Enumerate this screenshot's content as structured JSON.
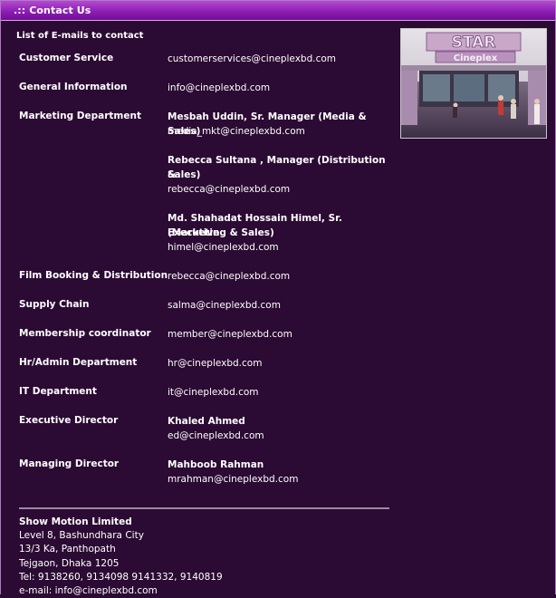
{
  "header": {
    "title": ".:: Contact Us"
  },
  "intro": "List of E-mails to contact",
  "contacts": [
    {
      "dept": "Customer Service",
      "lines": [
        {
          "t": "customerservices@cineplexbd.com",
          "b": false
        }
      ]
    },
    {
      "dept": "General Information",
      "lines": [
        {
          "t": "info@cineplexbd.com",
          "b": false
        }
      ]
    },
    {
      "dept": "Marketing Department",
      "lines": [
        {
          "t": "Mesbah Uddin, Sr. Manager (Media & Sales)",
          "b": true
        },
        {
          "t": "media_mkt@cineplexbd.com",
          "b": false
        },
        {
          "t": "",
          "b": false
        },
        {
          "t": "Rebecca Sultana , Manager (Distribution &",
          "b": true
        },
        {
          "t": "Sales)",
          "b": true
        },
        {
          "t": "rebecca@cineplexbd.com",
          "b": false
        },
        {
          "t": "",
          "b": false
        },
        {
          "t": "Md. Shahadat Hossain Himel, Sr. Executive",
          "b": true
        },
        {
          "t": "(Marketing & Sales)",
          "b": true
        },
        {
          "t": "himel@cineplexbd.com",
          "b": false
        }
      ]
    },
    {
      "dept": "Film Booking & Distribution",
      "lines": [
        {
          "t": "rebecca@cineplexbd.com",
          "b": false
        }
      ]
    },
    {
      "dept": "Supply Chain",
      "lines": [
        {
          "t": "salma@cineplexbd.com",
          "b": false
        }
      ]
    },
    {
      "dept": "Membership coordinator",
      "lines": [
        {
          "t": "member@cineplexbd.com",
          "b": false
        }
      ]
    },
    {
      "dept": "Hr/Admin Department",
      "lines": [
        {
          "t": "hr@cineplexbd.com",
          "b": false
        }
      ]
    },
    {
      "dept": "IT Department",
      "lines": [
        {
          "t": "it@cineplexbd.com",
          "b": false
        }
      ]
    },
    {
      "dept": "Executive Director",
      "lines": [
        {
          "t": "Khaled Ahmed",
          "b": true
        },
        {
          "t": "ed@cineplexbd.com",
          "b": false
        }
      ]
    },
    {
      "dept": "Managing Director",
      "lines": [
        {
          "t": "Mahboob Rahman",
          "b": true
        },
        {
          "t": "mrahman@cineplexbd.com",
          "b": false
        }
      ]
    }
  ],
  "photo": {
    "sign_top": "STAR",
    "sign_bottom": "Cineplex"
  },
  "footer": {
    "company": "Show Motion Limited",
    "lines": [
      "Level 8, Bashundhara City",
      "13/3 Ka, Panthopath",
      "Tejgaon, Dhaka 1205",
      "Tel: 9138260, 9134098 9141332, 9140819",
      "e-mail: info@cineplexbd.com"
    ]
  }
}
